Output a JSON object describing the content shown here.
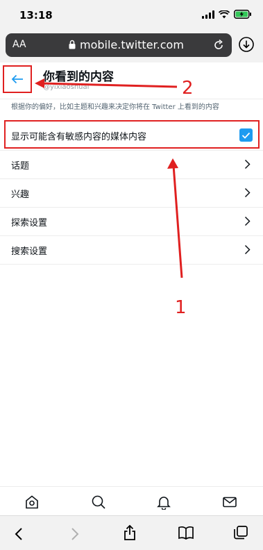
{
  "status_bar": {
    "time": "13:18"
  },
  "browser": {
    "text_size_label": "AA",
    "url": "mobile.twitter.com"
  },
  "header": {
    "title": "你看到的内容",
    "subtitle": "@yixiaoshuai"
  },
  "description": "根据你的偏好，比如主题和兴趣来决定你将在 Twitter 上看到的内容",
  "sensitive_media": {
    "label": "显示可能含有敏感内容的媒体内容",
    "checked": true
  },
  "settings_rows": [
    {
      "label": "话题"
    },
    {
      "label": "兴趣"
    },
    {
      "label": "探索设置"
    },
    {
      "label": "搜索设置"
    }
  ],
  "annotations": {
    "one": "1",
    "two": "2"
  },
  "colors": {
    "accent": "#1d9bf0",
    "annotation": "#e02020"
  }
}
